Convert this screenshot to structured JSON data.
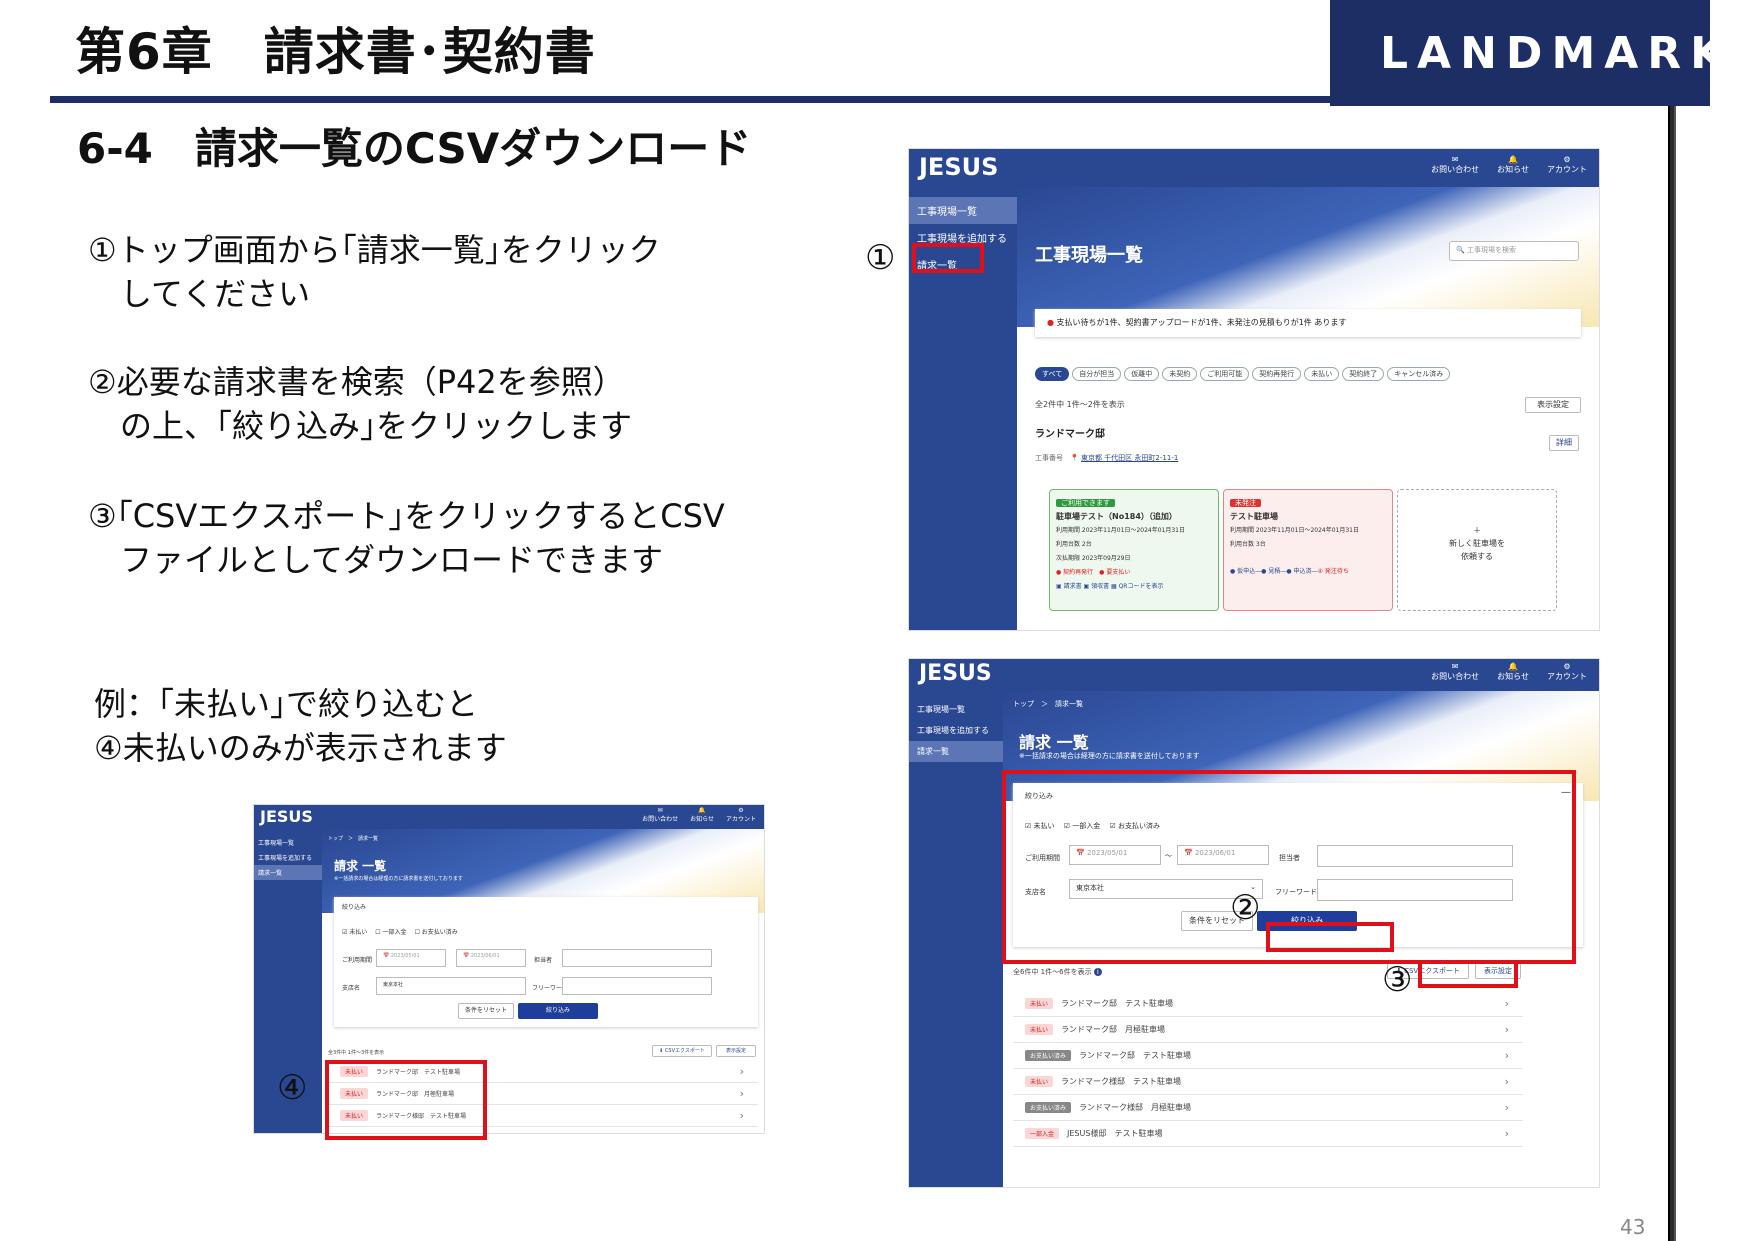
{
  "header": {
    "chapter_title": "第6章　請求書･契約書",
    "logo_text": "LANDMARK",
    "brand_color": "#1c2e63"
  },
  "section_title": "6-4　請求一覧のCSVダウンロード",
  "steps": [
    "①トップ画面から｢請求一覧｣をクリック\n　してください",
    "②必要な請求書を検索（P42を参照）\n　の上、｢絞り込み｣をクリックします",
    "③｢CSVエクスポート｣をクリックするとCSV\n　ファイルとしてダウンロードできます",
    "例：｢未払い｣で絞り込むと\n④未払いのみが表示されます"
  ],
  "markers": [
    "①",
    "②",
    "③",
    "④"
  ],
  "page_number": "43",
  "app": {
    "brand": "JESUS",
    "nav": [
      "お問い合わせ",
      "お知らせ",
      "アカウント"
    ],
    "sidebar": [
      "工事現場一覧",
      "工事現場を追加する",
      "請求一覧"
    ]
  },
  "shot1": {
    "title": "工事現場一覧",
    "search_placeholder": "工事現場を検索",
    "alert": "支払い待ちが1件、契約書アップロードが1件、未発注の見積もりが1件 あります",
    "filters": [
      "すべて",
      "自分が担当",
      "仮離中",
      "未契約",
      "ご利用可能",
      "契約再発行",
      "未払い",
      "契約終了",
      "キャンセル済み"
    ],
    "count": "全2件中 1件〜2件を表示",
    "display_settings": "表示設定",
    "site_name": "ランドマーク邸",
    "detail": "詳細",
    "site_label": "工事番号",
    "address": "東京都 千代田区 永田町2-11-1",
    "card1": {
      "badge": "ご利用できます",
      "name": "駐車場テスト（No184）（追加）",
      "period": "利用期間 2023年11月01日〜2024年01月31日",
      "count": "利用台数 2台",
      "date": "次払期限 2023年09月29日",
      "tags": [
        "契約再発行",
        "要支払い"
      ],
      "actions": [
        "請求書",
        "領収書",
        "QRコードを表示"
      ]
    },
    "card2": {
      "badge": "未発注",
      "name": "テスト駐車場",
      "period": "利用期間 2023年11月01日〜2024年01月31日",
      "count": "利用台数 3台",
      "progress": [
        "仮申込",
        "見積",
        "申込済",
        "発注待ち"
      ]
    },
    "add_card": "新しく駐車場を\n依頼する"
  },
  "shot2": {
    "breadcrumb": "トップ　＞　請求一覧",
    "title": "請求 一覧",
    "subtitle": "※一括請求の場合は経理の方に請求書を送付しております",
    "panel_title": "絞り込み",
    "checks": [
      "未払い",
      "一部入金",
      "お支払い済み"
    ],
    "period_label": "ご利用期間",
    "date_from": "2023/05/01",
    "date_to": "2023/06/01",
    "person_label": "担当者",
    "branch_label": "支店名",
    "branch_value": "東京本社",
    "keyword_label": "フリーワード",
    "reset": "条件をリセット",
    "submit": "絞り込み",
    "count": "全6件中 1件〜6件を表示",
    "csv": "CSVエクスポート",
    "display_settings": "表示設定",
    "rows": [
      {
        "status": "未払い",
        "text": "ランドマーク邸　テスト駐車場"
      },
      {
        "status": "未払い",
        "text": "ランドマーク邸　月極駐車場"
      },
      {
        "status": "お支払い済み",
        "text": "ランドマーク邸　テスト駐車場"
      },
      {
        "status": "未払い",
        "text": "ランドマーク様邸　テスト駐車場"
      },
      {
        "status": "お支払い済み",
        "text": "ランドマーク様邸　月極駐車場"
      },
      {
        "status": "一部入金",
        "text": "JESUS様邸　テスト駐車場"
      }
    ]
  },
  "shot3": {
    "count": "全3件中 1件〜3件を表示",
    "rows": [
      {
        "status": "未払い",
        "text": "ランドマーク邸　テスト駐車場"
      },
      {
        "status": "未払い",
        "text": "ランドマーク邸　月極駐車場"
      },
      {
        "status": "未払い",
        "text": "ランドマーク様邸　テスト駐車場"
      }
    ]
  }
}
